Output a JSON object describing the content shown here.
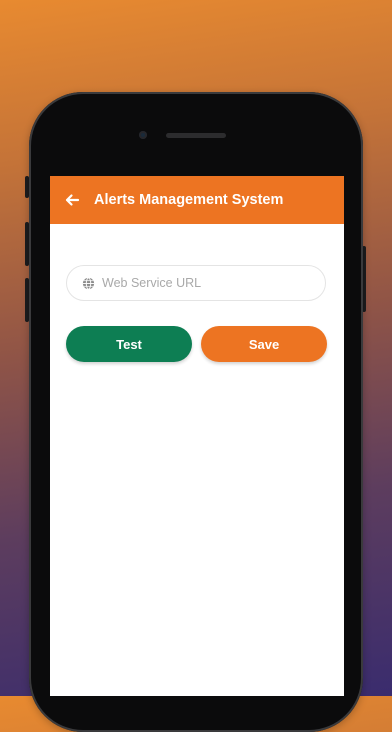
{
  "app_bar": {
    "title": "Alerts Management System",
    "back_icon": "arrow-left-icon",
    "background_color": "#ed7422"
  },
  "form": {
    "web_service_url": {
      "icon": "globe-icon",
      "placeholder": "Web Service URL",
      "value": ""
    }
  },
  "actions": {
    "test_label": "Test",
    "test_color": "#0d7e53",
    "save_label": "Save",
    "save_color": "#ed7422"
  }
}
